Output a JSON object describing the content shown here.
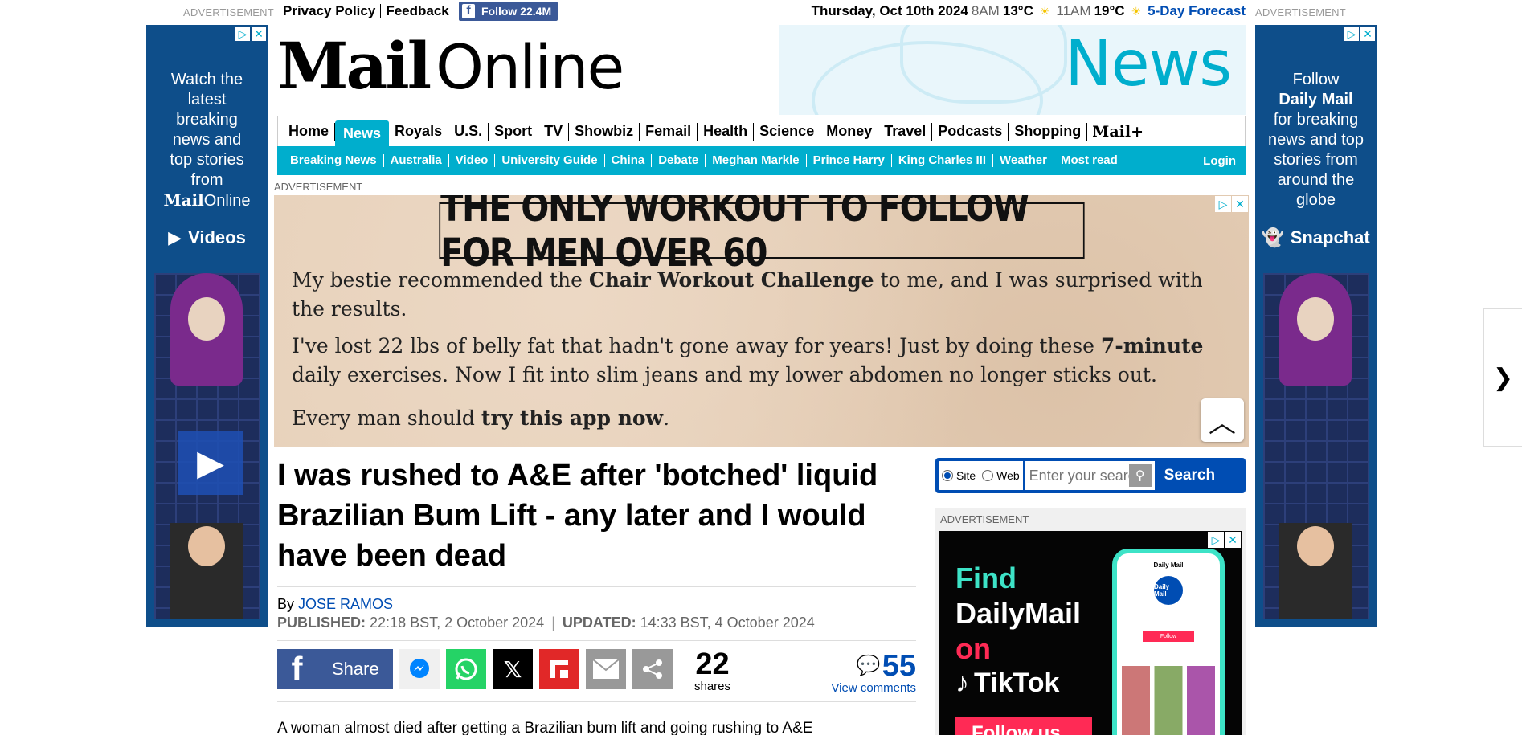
{
  "topbar": {
    "ad_label": "ADVERTISEMENT",
    "links": [
      "Privacy Policy",
      "Feedback"
    ],
    "facebook_follow": "Follow 22.4M",
    "date": "Thursday, Oct 10th 2024",
    "weather": [
      {
        "time": "8AM",
        "temp": "13°C"
      },
      {
        "time": "11AM",
        "temp": "19°C"
      }
    ],
    "forecast_link": "5-Day Forecast"
  },
  "sky_left": {
    "copy_lines": [
      "Watch the",
      "latest",
      "breaking",
      "news and",
      "top stories",
      "from"
    ],
    "brand": "Mail",
    "brand_suffix": "Online",
    "cta": "Videos"
  },
  "sky_right": {
    "copy_lines": [
      "Follow"
    ],
    "brand": "Daily Mail",
    "copy_lines_2": [
      "for breaking",
      "news and top",
      "stories from",
      "around the",
      "globe"
    ],
    "cta": "Snapchat"
  },
  "masthead": {
    "logo_main": "Mail",
    "logo_suffix": "Online",
    "section": "News"
  },
  "nav": {
    "items": [
      "Home",
      "News",
      "Royals",
      "U.S.",
      "Sport",
      "TV",
      "Showbiz",
      "Femail",
      "Health",
      "Science",
      "Money",
      "Travel",
      "Podcasts",
      "Shopping"
    ],
    "active": "News",
    "mailplus": "Mail+"
  },
  "subnav": {
    "items": [
      "Breaking News",
      "Australia",
      "Video",
      "University Guide",
      "China",
      "Debate",
      "Meghan Markle",
      "Prince Harry",
      "King Charles III",
      "Weather",
      "Most read"
    ],
    "login": "Login"
  },
  "leaderboard": {
    "label": "ADVERTISEMENT",
    "headline": "THE ONLY WORKOUT TO FOLLOW FOR MEN OVER 60",
    "p1_a": "My bestie recommended the ",
    "p1_b": "Chair Workout Challenge",
    "p1_c": " to me, and I was surprised with the results.",
    "p2_a": "I've lost 22 lbs of belly fat that hadn't gone away for years! Just by doing these ",
    "p2_b": "7-minute",
    "p2_c": " daily exercises. Now I fit into slim jeans and my lower abdomen no longer sticks out.",
    "p3_a": "Every man should ",
    "p3_b": "try this app now",
    "p3_c": "."
  },
  "article": {
    "headline": "I was rushed to A&E after 'botched' liquid Brazilian Bum Lift - any later and I would have been dead",
    "by": "By",
    "author": "JOSE RAMOS",
    "published_label": "PUBLISHED:",
    "published": "22:18 BST, 2 October 2024",
    "updated_label": "UPDATED:",
    "updated": "14:33 BST, 4 October 2024",
    "share_label": "Share",
    "shares_count": "22",
    "shares_label": "shares",
    "comments_count": "55",
    "comments_label": "View comments",
    "first_line": "A woman almost died after getting a Brazilian bum lift and going rushing to A&E"
  },
  "search": {
    "option_site": "Site",
    "option_web": "Web",
    "placeholder": "Enter your search",
    "button": "Search"
  },
  "mpu": {
    "label": "ADVERTISEMENT",
    "line1": "Find",
    "line2": "DailyMail",
    "line3": "on",
    "line4": "TikTok",
    "button": "Follow us",
    "phone_title": "Daily Mail",
    "phone_logo": "Daily Mail",
    "phone_follow": "Follow"
  },
  "colors": {
    "accent": "#00aecd",
    "link": "#004db3",
    "facebook": "#3b5998"
  }
}
